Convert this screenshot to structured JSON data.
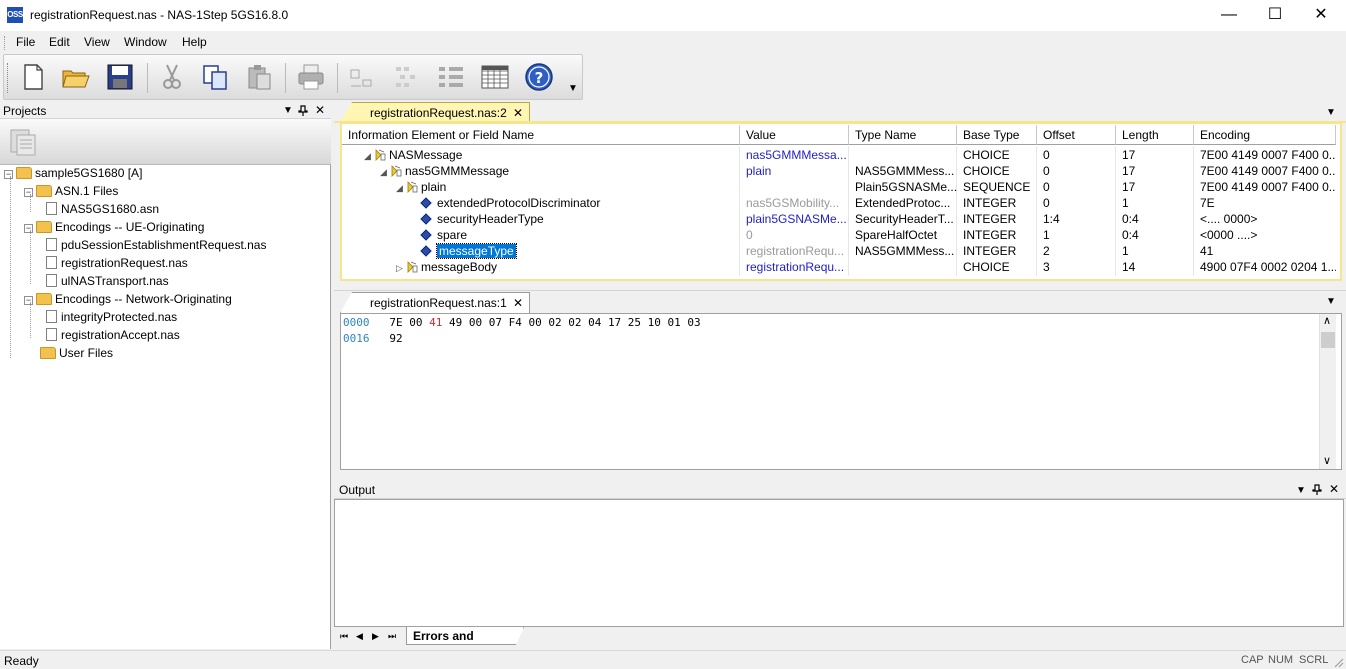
{
  "window": {
    "icon_text": "OSS",
    "title": "registrationRequest.nas - NAS-1Step 5GS16.8.0",
    "minimize": "—",
    "maximize": "☐",
    "close": "✕"
  },
  "menu": [
    "File",
    "Edit",
    "View",
    "Window",
    "Help"
  ],
  "toolbar": {
    "icons": [
      "new-icon",
      "open-icon",
      "save-icon",
      "cut-icon",
      "copy-icon",
      "paste-icon",
      "print-icon",
      "encode-icon",
      "decode-icon",
      "tree-icon",
      "table-icon",
      "help-icon"
    ]
  },
  "projects": {
    "header": "Projects",
    "pin": "ᵖ",
    "close": "✕",
    "tree": [
      {
        "label": "sample5GS1680 [A]",
        "level": 0,
        "kind": "folder",
        "expander": "−"
      },
      {
        "label": "ASN.1 Files",
        "level": 1,
        "kind": "folder",
        "expander": "−"
      },
      {
        "label": "NAS5GS1680.asn",
        "level": 2,
        "kind": "file"
      },
      {
        "label": "Encodings -- UE-Originating",
        "level": 1,
        "kind": "folder",
        "expander": "−"
      },
      {
        "label": "pduSessionEstablishmentRequest.nas",
        "level": 2,
        "kind": "file"
      },
      {
        "label": "registrationRequest.nas",
        "level": 2,
        "kind": "file"
      },
      {
        "label": "ulNASTransport.nas",
        "level": 2,
        "kind": "file"
      },
      {
        "label": "Encodings -- Network-Originating",
        "level": 1,
        "kind": "folder",
        "expander": "−"
      },
      {
        "label": "integrityProtected.nas",
        "level": 2,
        "kind": "file"
      },
      {
        "label": "registrationAccept.nas",
        "level": 2,
        "kind": "file"
      },
      {
        "label": "User Files",
        "level": 1,
        "kind": "folder"
      }
    ]
  },
  "editor_tab": {
    "label": "registrationRequest.nas:2",
    "close": "✕"
  },
  "table": {
    "columns": [
      "Information Element or Field Name",
      "Value",
      "Type Name",
      "Base Type",
      "Offset",
      "Length",
      "Encoding"
    ],
    "rows": [
      {
        "indent": 0,
        "tri": "◢",
        "icon": "struct",
        "name": "NASMessage",
        "value": "nas5GMMMessa...",
        "value_style": "blue",
        "type": "",
        "base": "CHOICE",
        "offset": "0",
        "length": "17",
        "encoding": "7E00 4149 0007 F400 0..."
      },
      {
        "indent": 1,
        "tri": "◢",
        "icon": "struct",
        "name": "nas5GMMMessage",
        "value": "plain",
        "value_style": "blue",
        "type": "NAS5GMMMess...",
        "base": "CHOICE",
        "offset": "0",
        "length": "17",
        "encoding": "7E00 4149 0007 F400 0..."
      },
      {
        "indent": 2,
        "tri": "◢",
        "icon": "struct",
        "name": "plain",
        "value": "",
        "value_style": "",
        "type": "Plain5GSNASMe...",
        "base": "SEQUENCE",
        "offset": "0",
        "length": "17",
        "encoding": "7E00 4149 0007 F400 0..."
      },
      {
        "indent": 3,
        "tri": "",
        "icon": "leaf",
        "name": "extendedProtocolDiscriminator",
        "value": "nas5GSMobility...",
        "value_style": "gray",
        "type": "ExtendedProtoc...",
        "base": "INTEGER",
        "offset": "0",
        "length": "1",
        "encoding": "7E"
      },
      {
        "indent": 3,
        "tri": "",
        "icon": "leaf",
        "name": "securityHeaderType",
        "value": "plain5GSNASMe...",
        "value_style": "blue",
        "type": "SecurityHeaderT...",
        "base": "INTEGER",
        "offset": "1:4",
        "length": "0:4",
        "encoding": "<.... 0000>"
      },
      {
        "indent": 3,
        "tri": "",
        "icon": "leaf",
        "name": "spare",
        "value": "0",
        "value_style": "gray",
        "type": "SpareHalfOctet",
        "base": "INTEGER",
        "offset": "1",
        "length": "0:4",
        "encoding": "<0000 ....>"
      },
      {
        "indent": 3,
        "tri": "",
        "icon": "leaf",
        "name": "messageType",
        "value": "registrationRequ...",
        "value_style": "gray",
        "type": "NAS5GMMMess...",
        "base": "INTEGER",
        "offset": "2",
        "length": "1",
        "encoding": "41",
        "selected": true
      },
      {
        "indent": 2,
        "tri": "▷",
        "icon": "struct",
        "name": "messageBody",
        "value": "registrationRequ...",
        "value_style": "blue",
        "type": "",
        "base": "CHOICE",
        "offset": "3",
        "length": "14",
        "encoding": "4900 07F4 0002 0204 1..."
      }
    ]
  },
  "hex_tab": {
    "label": "registrationRequest.nas:1",
    "close": "✕"
  },
  "hex": {
    "lines": [
      {
        "offset": "0000",
        "before": "7E 00 ",
        "highlight": "41",
        "after": " 49 00 07 F4 00 02 02 04 17 25 10 01 03"
      },
      {
        "offset": "0016",
        "before": "92",
        "highlight": "",
        "after": ""
      }
    ],
    "scroll_up": "∧",
    "scroll_down": "∨"
  },
  "output": {
    "header": "Output",
    "pin": "ᵖ",
    "close": "✕",
    "nav": [
      "⏮",
      "◀",
      "▶",
      "⏭"
    ],
    "tab": "Errors and warnings"
  },
  "status": {
    "text": "Ready",
    "indicators": [
      "CAP",
      "NUM",
      "SCRL"
    ]
  },
  "colors": {
    "accent": "#1e1ec8",
    "selection": "#0078d7",
    "active_tab": "#fff6b4",
    "hex_offset": "#2e86c1",
    "hex_highlight": "#d62728"
  }
}
